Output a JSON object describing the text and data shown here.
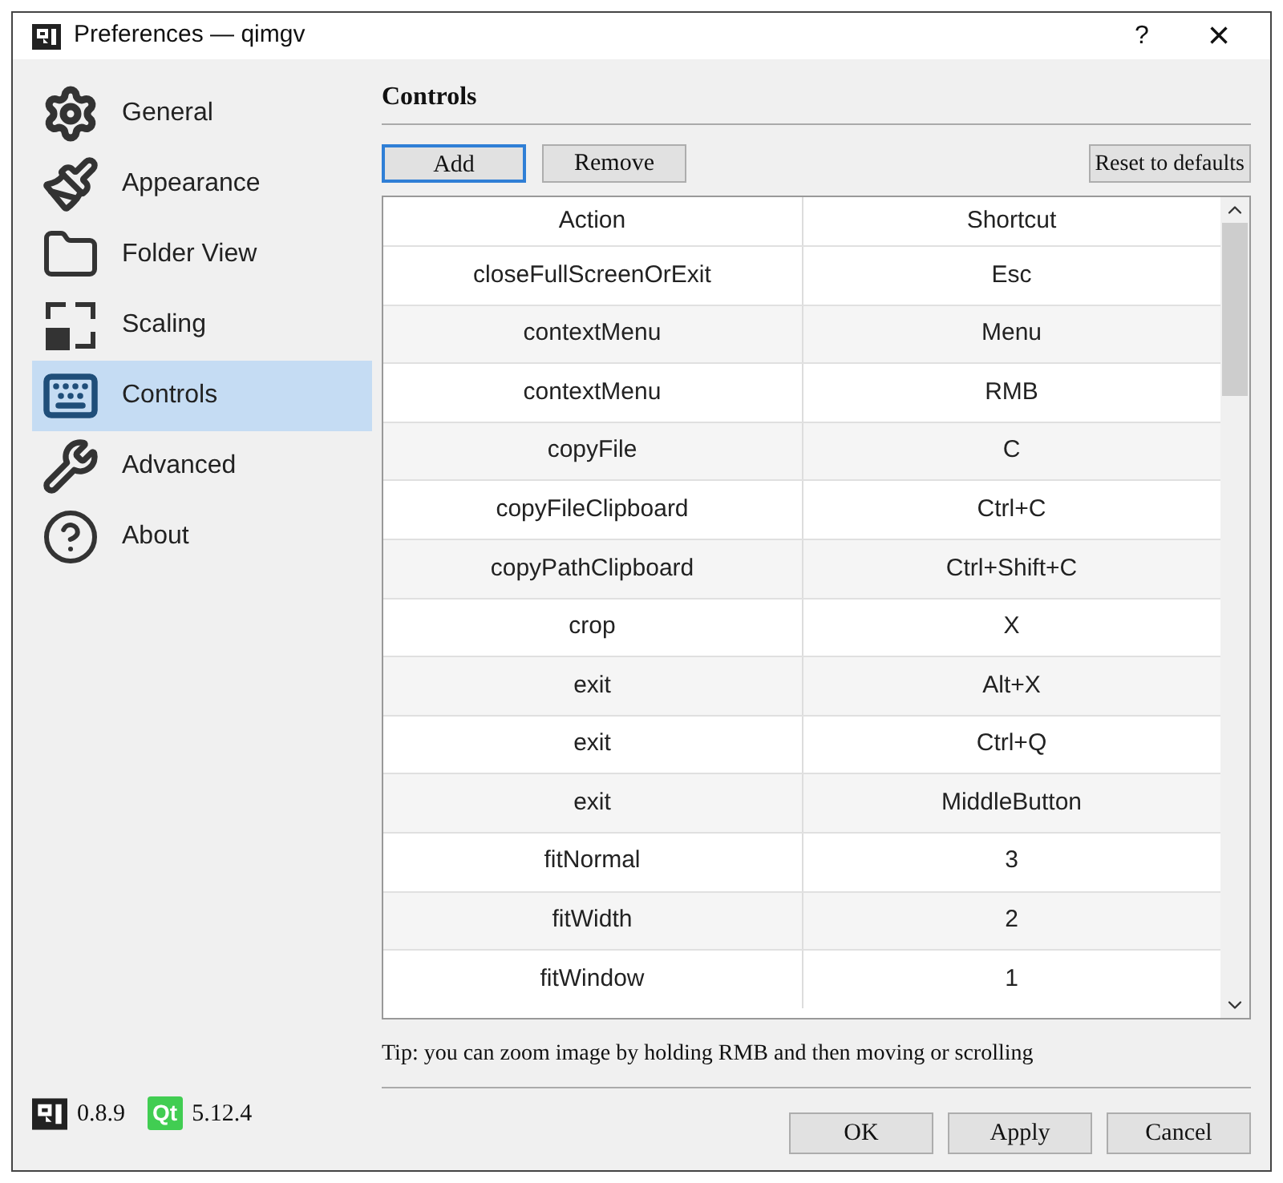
{
  "window": {
    "title": "Preferences — qimgv",
    "help": "?",
    "close": "×"
  },
  "sidebar": {
    "items": [
      {
        "label": "General",
        "kind": "gear",
        "selected": false
      },
      {
        "label": "Appearance",
        "kind": "brush",
        "selected": false
      },
      {
        "label": "Folder View",
        "kind": "folder",
        "selected": false
      },
      {
        "label": "Scaling",
        "kind": "scaling",
        "selected": false
      },
      {
        "label": "Controls",
        "kind": "keyboard",
        "selected": true
      },
      {
        "label": "Advanced",
        "kind": "wrench",
        "selected": false
      },
      {
        "label": "About",
        "kind": "help",
        "selected": false
      }
    ]
  },
  "section": {
    "title": "Controls"
  },
  "toolbar": [
    {
      "label": "Add",
      "focused": true
    },
    {
      "label": "Remove",
      "focused": false
    }
  ],
  "reset_button": "Reset to defaults",
  "table": {
    "columns": [
      "Action",
      "Shortcut"
    ],
    "rows": [
      [
        "closeFullScreenOrExit",
        "Esc"
      ],
      [
        "contextMenu",
        "Menu"
      ],
      [
        "contextMenu",
        "RMB"
      ],
      [
        "copyFile",
        "C"
      ],
      [
        "copyFileClipboard",
        "Ctrl+C"
      ],
      [
        "copyPathClipboard",
        "Ctrl+Shift+C"
      ],
      [
        "crop",
        "X"
      ],
      [
        "exit",
        "Alt+X"
      ],
      [
        "exit",
        "Ctrl+Q"
      ],
      [
        "exit",
        "MiddleButton"
      ],
      [
        "fitNormal",
        "3"
      ],
      [
        "fitWidth",
        "2"
      ],
      [
        "fitWindow",
        "1"
      ]
    ]
  },
  "tip": "Tip: you can zoom image by holding RMB and then moving or scrolling",
  "footer": {
    "app_version": "0.8.9",
    "qt_logo": "Qt",
    "qt_version": "5.12.4"
  },
  "buttons": [
    "OK",
    "Apply",
    "Cancel"
  ]
}
